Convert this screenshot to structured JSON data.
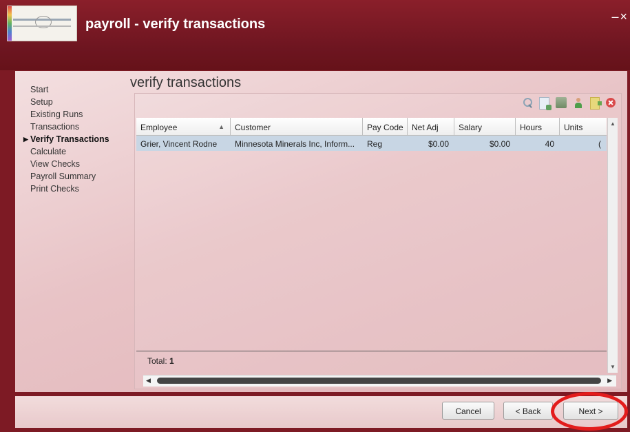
{
  "window": {
    "title": "payroll - verify transactions",
    "controls": [
      "–",
      "×"
    ]
  },
  "sidebar": {
    "items": [
      {
        "label": "Start"
      },
      {
        "label": "Setup"
      },
      {
        "label": "Existing Runs"
      },
      {
        "label": "Transactions"
      },
      {
        "label": "Verify Transactions",
        "active": true
      },
      {
        "label": "Calculate"
      },
      {
        "label": "View Checks"
      },
      {
        "label": "Payroll Summary"
      },
      {
        "label": "Print Checks"
      }
    ]
  },
  "main": {
    "title": "verify transactions",
    "toolbar_icons": [
      "search-icon",
      "document-icon",
      "money-icon",
      "person-icon",
      "export-icon",
      "delete-icon"
    ],
    "grid": {
      "columns": [
        "Employee",
        "Customer",
        "Pay Code",
        "Net Adj",
        "Salary",
        "Hours",
        "Units"
      ],
      "sort_column": "Employee",
      "sort_direction": "ascending",
      "rows": [
        {
          "employee": "Grier, Vincent Rodne",
          "customer": "Minnesota Minerals Inc, Inform...",
          "pay_code": "Reg",
          "net_adj": "$0.00",
          "salary": "$0.00",
          "hours": "40",
          "units": "("
        }
      ],
      "total_label": "Total:",
      "total_value": "1"
    }
  },
  "buttons": {
    "cancel": "Cancel",
    "back": "< Back",
    "next": "Next >"
  },
  "colors": {
    "titlebar": "#7d1a24",
    "content_bg": "#e8c3c6",
    "selected_row": "#c8d6e4",
    "highlight": "#e31c1c"
  }
}
